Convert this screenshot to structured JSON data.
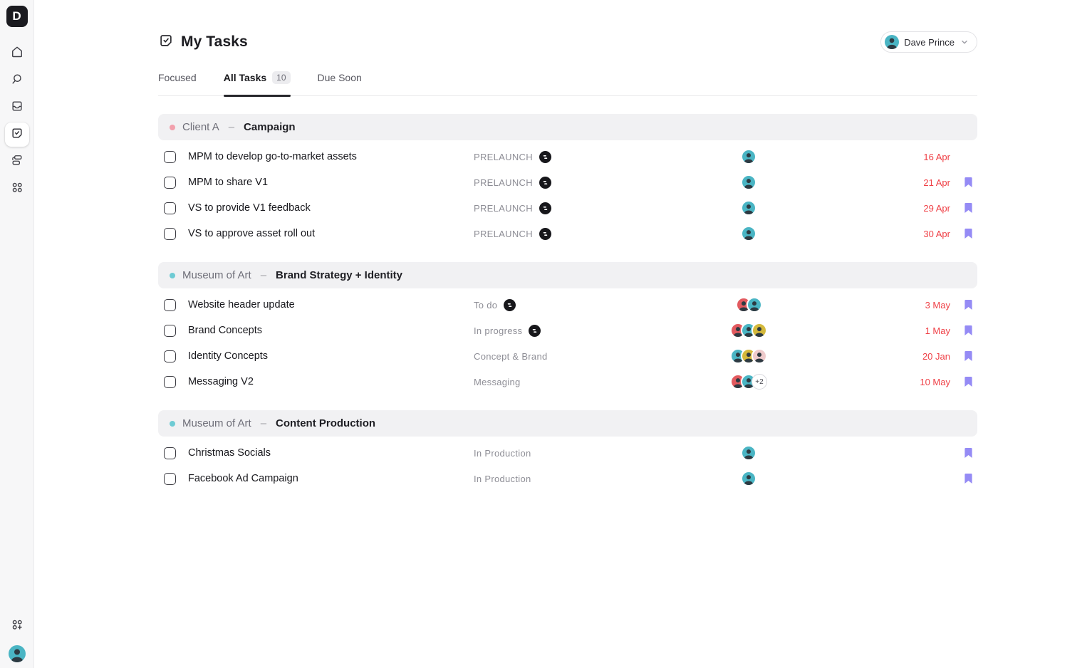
{
  "app": {
    "logo_letter": "D"
  },
  "ui": {
    "dash": "–",
    "bookmark_color": "#958bf5",
    "date_color": "#ef4046"
  },
  "sidebar": {
    "items": [
      {
        "name": "home"
      },
      {
        "name": "search"
      },
      {
        "name": "inbox"
      },
      {
        "name": "my-tasks",
        "active": true
      },
      {
        "name": "workflows"
      },
      {
        "name": "apps"
      }
    ],
    "bottom": [
      {
        "name": "invite"
      },
      {
        "name": "user-avatar"
      }
    ]
  },
  "header": {
    "title": "My Tasks",
    "user": {
      "name": "Dave Prince",
      "avatar_color": "teal"
    }
  },
  "tabs": [
    {
      "label": "Focused",
      "active": false
    },
    {
      "label": "All Tasks",
      "badge": "10",
      "active": true
    },
    {
      "label": "Due Soon",
      "active": false
    }
  ],
  "avatar_colors": {
    "teal": "#4ab5c4",
    "coral": "#e25a5f",
    "yellow": "#d4b93c",
    "pink": "#eecacb"
  },
  "groups": [
    {
      "client": "Client A",
      "dot_color": "#f2a0ac",
      "project": "Campaign",
      "tasks": [
        {
          "name": "MPM to develop go-to-market assets",
          "status": "PRELAUNCH",
          "status_icon": true,
          "avatars": [
            "teal"
          ],
          "more": "",
          "due": "16 Apr",
          "bookmark": false
        },
        {
          "name": "MPM to share V1",
          "status": "PRELAUNCH",
          "status_icon": true,
          "avatars": [
            "teal"
          ],
          "more": "",
          "due": "21 Apr",
          "bookmark": true
        },
        {
          "name": "VS to provide V1 feedback",
          "status": "PRELAUNCH",
          "status_icon": true,
          "avatars": [
            "teal"
          ],
          "more": "",
          "due": "29 Apr",
          "bookmark": true
        },
        {
          "name": "VS to approve asset roll out",
          "status": "PRELAUNCH",
          "status_icon": true,
          "avatars": [
            "teal"
          ],
          "more": "",
          "due": "30 Apr",
          "bookmark": true
        }
      ]
    },
    {
      "client": "Museum of Art",
      "dot_color": "#6ecbd4",
      "project": "Brand Strategy + Identity",
      "tasks": [
        {
          "name": "Website header update",
          "status": "To do",
          "status_icon": true,
          "avatars": [
            "coral",
            "teal"
          ],
          "more": "",
          "due": "3 May",
          "bookmark": true
        },
        {
          "name": "Brand Concepts",
          "status": "In progress",
          "status_icon": true,
          "avatars": [
            "coral",
            "teal",
            "yellow"
          ],
          "more": "",
          "due": "1 May",
          "bookmark": true
        },
        {
          "name": "Identity Concepts",
          "status": "Concept & Brand",
          "status_icon": false,
          "avatars": [
            "teal",
            "yellow",
            "pink"
          ],
          "more": "",
          "due": "20 Jan",
          "bookmark": true
        },
        {
          "name": "Messaging V2",
          "status": "Messaging",
          "status_icon": false,
          "avatars": [
            "coral",
            "teal"
          ],
          "more": "+2",
          "due": "10 May",
          "bookmark": true
        }
      ]
    },
    {
      "client": "Museum of Art",
      "dot_color": "#6ecbd4",
      "project": "Content Production",
      "tasks": [
        {
          "name": "Christmas Socials",
          "status": "In Production",
          "status_icon": false,
          "avatars": [
            "teal"
          ],
          "more": "",
          "due": "",
          "bookmark": true
        },
        {
          "name": "Facebook Ad Campaign",
          "status": "In Production",
          "status_icon": false,
          "avatars": [
            "teal"
          ],
          "more": "",
          "due": "",
          "bookmark": true
        }
      ]
    }
  ]
}
